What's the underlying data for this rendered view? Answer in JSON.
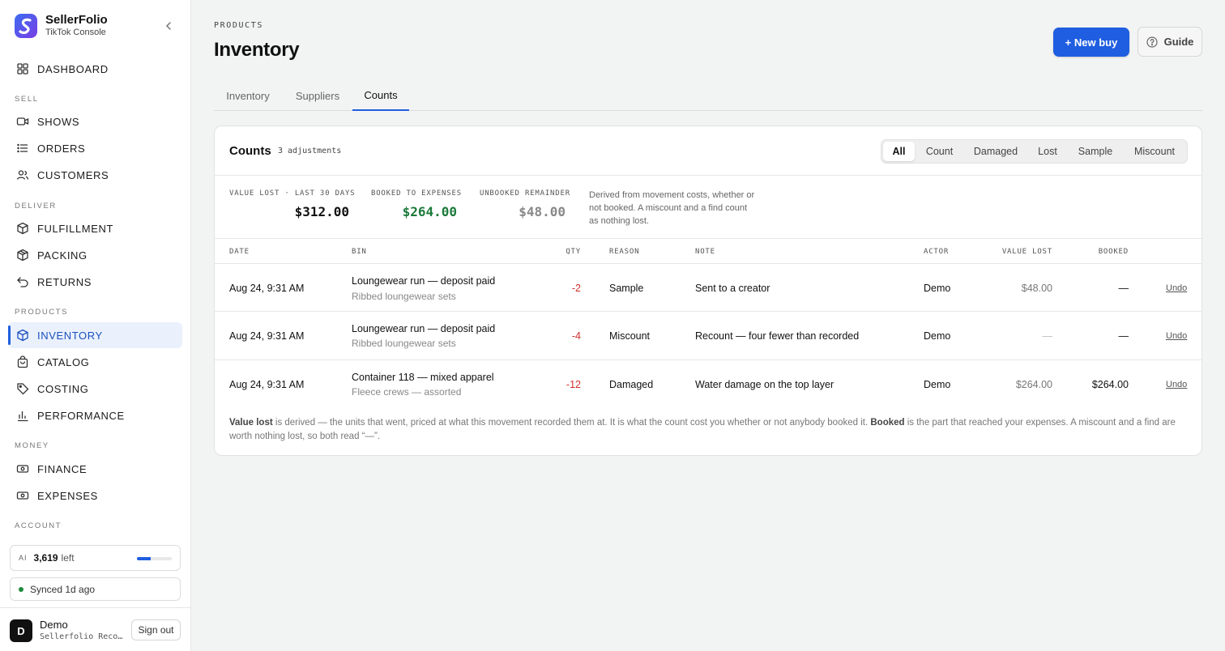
{
  "brand": {
    "name": "SellerFolio",
    "subtitle": "TikTok Console"
  },
  "sidebar": {
    "dashboard": "DASHBOARD",
    "sections": {
      "sell": "SELL",
      "deliver": "DELIVER",
      "products": "PRODUCTS",
      "money": "MONEY",
      "account": "ACCOUNT"
    },
    "items": {
      "shows": "SHOWS",
      "orders": "ORDERS",
      "customers": "CUSTOMERS",
      "fulfillment": "FULFILLMENT",
      "packing": "PACKING",
      "returns": "RETURNS",
      "inventory": "INVENTORY",
      "catalog": "CATALOG",
      "costing": "COSTING",
      "performance": "PERFORMANCE",
      "finance": "FINANCE",
      "expenses": "EXPENSES"
    },
    "ai": {
      "tag": "AI",
      "count": "3,619",
      "suffix": "left",
      "usage_fraction": 0.4
    },
    "sync": "Synced 1d ago",
    "user": {
      "initial": "D",
      "name": "Demo",
      "org": "Sellerfolio Recordings",
      "signout": "Sign out"
    }
  },
  "header": {
    "breadcrumb": "PRODUCTS",
    "title": "Inventory",
    "new_buy": "+ New buy",
    "guide": "Guide"
  },
  "tabs": [
    "Inventory",
    "Suppliers",
    "Counts"
  ],
  "counts": {
    "title": "Counts",
    "subtitle": "3 adjustments",
    "filters": [
      "All",
      "Count",
      "Damaged",
      "Lost",
      "Sample",
      "Miscount"
    ],
    "stats": {
      "value_lost_label": "VALUE LOST · LAST 30 DAYS",
      "value_lost": "$312.00",
      "booked_label": "BOOKED TO EXPENSES",
      "booked": "$264.00",
      "unbooked_label": "UNBOOKED REMAINDER",
      "unbooked": "$48.00",
      "note": "Derived from movement costs, whether or not booked. A miscount and a find count as nothing lost."
    },
    "columns": {
      "date": "DATE",
      "bin": "BIN",
      "qty": "QTY",
      "reason": "REASON",
      "note": "NOTE",
      "actor": "ACTOR",
      "value_lost": "VALUE LOST",
      "booked": "BOOKED"
    },
    "rows": [
      {
        "date": "Aug 24, 9:31 AM",
        "bin": "Loungewear run — deposit paid",
        "bin_sub": "Ribbed loungewear sets",
        "qty": "-2",
        "reason": "Sample",
        "note": "Sent to a creator",
        "actor": "Demo",
        "value_lost": "$48.00",
        "booked": "—",
        "action": "Undo"
      },
      {
        "date": "Aug 24, 9:31 AM",
        "bin": "Loungewear run — deposit paid",
        "bin_sub": "Ribbed loungewear sets",
        "qty": "-4",
        "reason": "Miscount",
        "note": "Recount — four fewer than recorded",
        "actor": "Demo",
        "value_lost": "—",
        "booked": "—",
        "action": "Undo"
      },
      {
        "date": "Aug 24, 9:31 AM",
        "bin": "Container 118 — mixed apparel",
        "bin_sub": "Fleece crews — assorted",
        "qty": "-12",
        "reason": "Damaged",
        "note": "Water damage on the top layer",
        "actor": "Demo",
        "value_lost": "$264.00",
        "booked": "$264.00",
        "action": "Undo"
      }
    ],
    "footnote": {
      "term1": "Value lost",
      "text1": " is derived — the units that went, priced at what this movement recorded them at. It is what the count cost you whether or not anybody booked it. ",
      "term2": "Booked",
      "text2": " is the part that reached your expenses. A miscount and a find are worth nothing lost, so both read “—”."
    }
  },
  "colors": {
    "accent": "#1f5ee0",
    "negative": "#d0312d",
    "positive": "#1b7a3a",
    "muted": "#888888"
  }
}
